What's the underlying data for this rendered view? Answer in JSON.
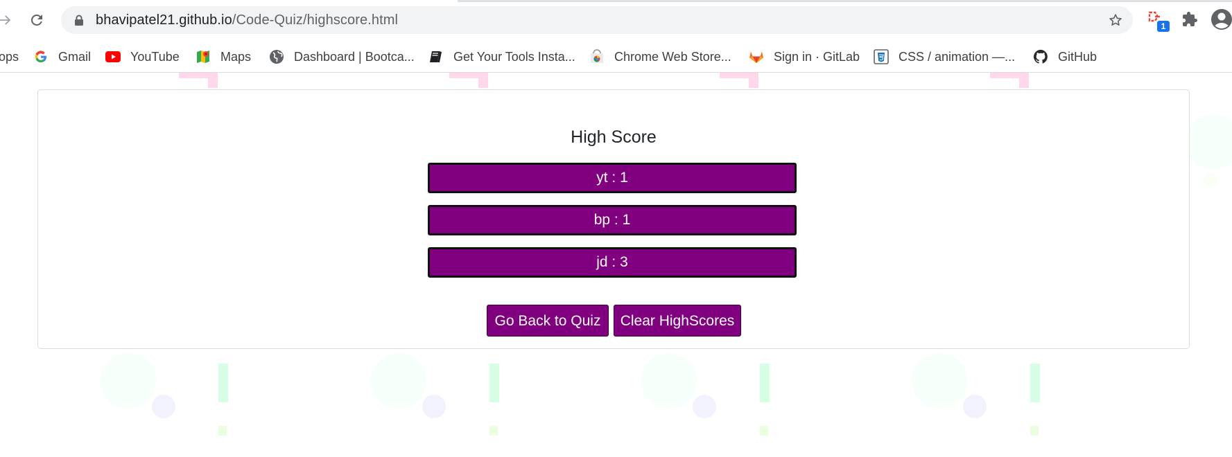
{
  "browser": {
    "url_host": "bhavipatel21.github.io",
    "url_path": "/Code-Quiz/highscore.html",
    "extension_badge": "1"
  },
  "bookmarks": [
    {
      "label": "ops",
      "icon": "apps-icon"
    },
    {
      "label": "Gmail",
      "icon": "google-icon"
    },
    {
      "label": "YouTube",
      "icon": "youtube-icon"
    },
    {
      "label": "Maps",
      "icon": "maps-icon"
    },
    {
      "label": "Dashboard | Bootca...",
      "icon": "globe-icon"
    },
    {
      "label": "Get Your Tools Insta...",
      "icon": "book-icon"
    },
    {
      "label": "Chrome Web Store...",
      "icon": "chrome-web-store-icon"
    },
    {
      "label": "Sign in · GitLab",
      "icon": "gitlab-icon"
    },
    {
      "label": "CSS / animation —...",
      "icon": "css-icon"
    },
    {
      "label": "GitHub",
      "icon": "github-icon"
    }
  ],
  "highscore": {
    "title": "High Score",
    "scores": [
      "yt : 1",
      "bp : 1",
      "jd : 3"
    ],
    "back_button": "Go Back to Quiz",
    "clear_button": "Clear HighScores"
  },
  "colors": {
    "accent": "#800080",
    "card_border": "#dcdcdc"
  }
}
